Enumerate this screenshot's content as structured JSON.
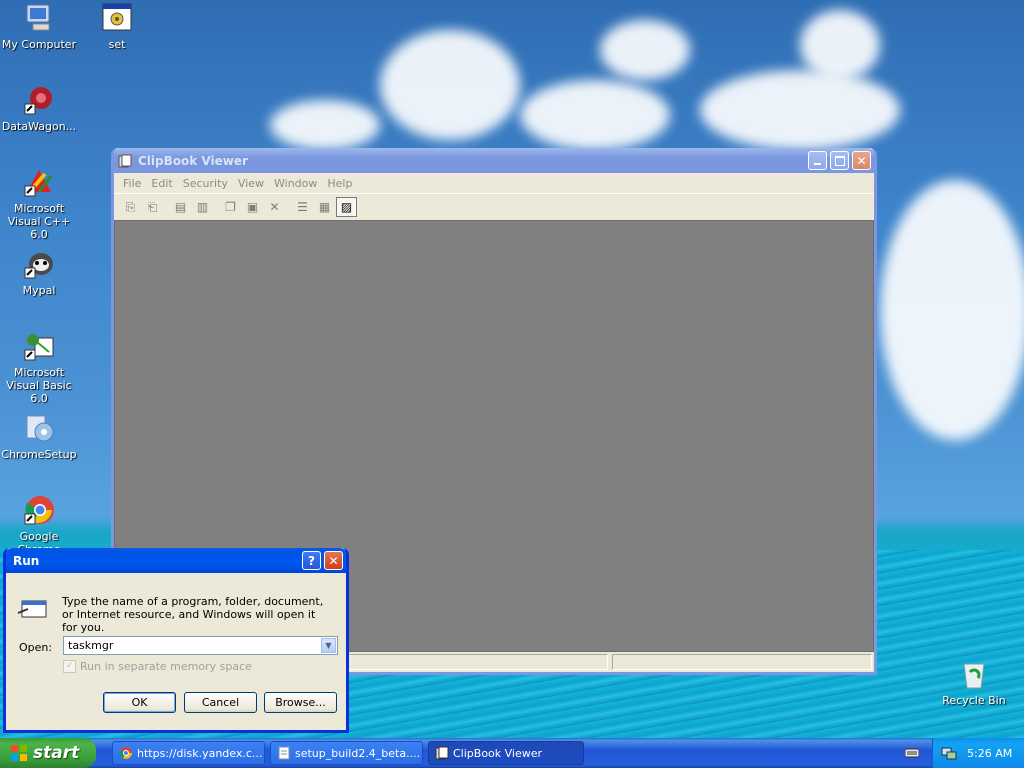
{
  "desktop": {
    "icons": [
      {
        "label": "My Computer"
      },
      {
        "label": "set"
      },
      {
        "label": "DataWagon..."
      },
      {
        "label": "Microsoft Visual C++ 6.0"
      },
      {
        "label": "Mypal"
      },
      {
        "label": "Microsoft Visual Basic 6.0"
      },
      {
        "label": "ChromeSetup"
      },
      {
        "label": "Google Chrome"
      },
      {
        "label": "Recycle Bin"
      }
    ]
  },
  "clipbook": {
    "title": "ClipBook Viewer",
    "menus": [
      "File",
      "Edit",
      "Security",
      "View",
      "Window",
      "Help"
    ]
  },
  "run": {
    "title": "Run",
    "help_btn": "?",
    "description": "Type the name of a program, folder, document, or Internet resource, and Windows will open it for you.",
    "open_label": "Open:",
    "open_value": "taskmgr",
    "checkbox_label": "Run in separate memory space",
    "ok": "OK",
    "cancel": "Cancel",
    "browse": "Browse..."
  },
  "taskbar": {
    "start": "start",
    "tasks": [
      {
        "label": "https://disk.yandex.c..."
      },
      {
        "label": "setup_build2.4_beta...."
      },
      {
        "label": "ClipBook Viewer"
      }
    ],
    "clock": "5:26 AM"
  }
}
